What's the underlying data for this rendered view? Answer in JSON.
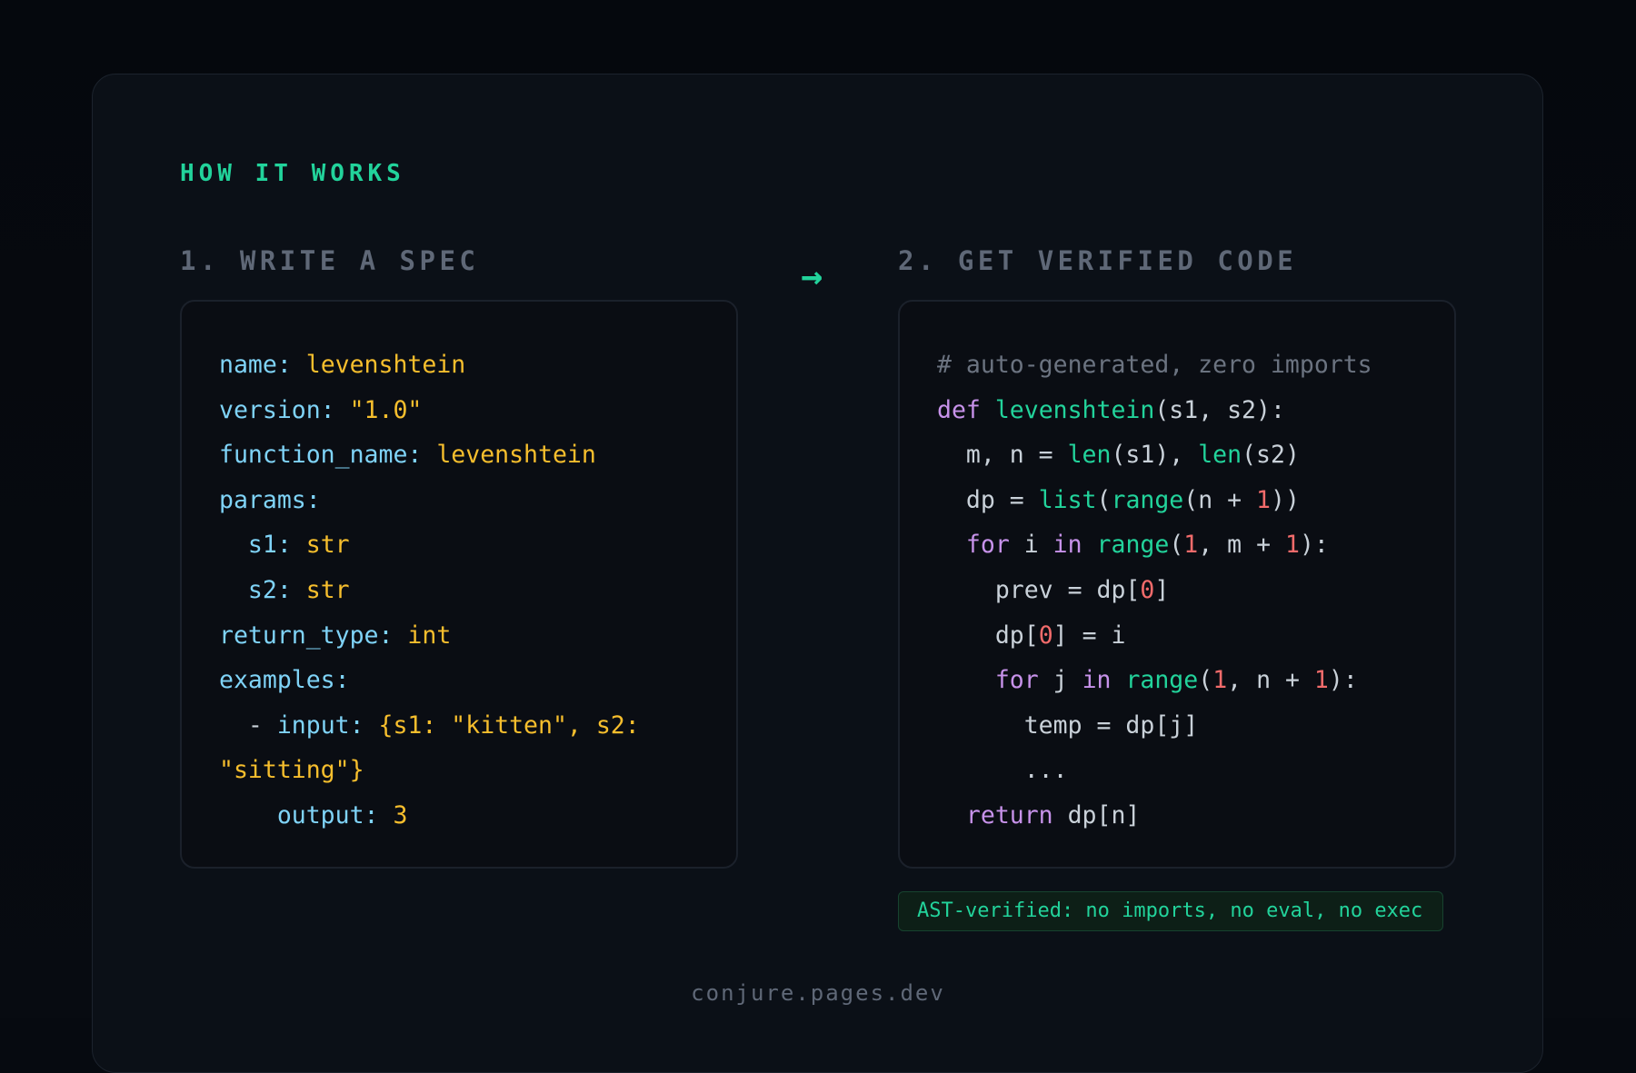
{
  "section_label": "HOW IT WORKS",
  "steps": {
    "spec_title": "1. WRITE A SPEC",
    "code_title": "2. GET VERIFIED CODE",
    "arrow": "→"
  },
  "colors": {
    "accent": "#22d39b",
    "yaml_key": "#7fd3f7",
    "yaml_value": "#f6be2d",
    "comment": "#6b7380",
    "keyword": "#c792ea",
    "number": "#f26b6b",
    "text": "#c9d1d9"
  },
  "spec_lines": [
    [
      [
        "k",
        "name: "
      ],
      [
        "v",
        "levenshtein"
      ]
    ],
    [
      [
        "k",
        "version: "
      ],
      [
        "v",
        "\"1.0\""
      ]
    ],
    [
      [
        "k",
        "function_name: "
      ],
      [
        "v",
        "levenshtein"
      ]
    ],
    [
      [
        "k",
        "params:"
      ]
    ],
    [
      [
        "k",
        "  s1: "
      ],
      [
        "v",
        "str"
      ]
    ],
    [
      [
        "k",
        "  s2: "
      ],
      [
        "v",
        "str"
      ]
    ],
    [
      [
        "k",
        "return_type: "
      ],
      [
        "v",
        "int"
      ]
    ],
    [
      [
        "k",
        "examples:"
      ]
    ],
    [
      [
        "tx",
        "  - "
      ],
      [
        "k",
        "input: "
      ],
      [
        "v",
        "{s1: \"kitten\", s2:"
      ]
    ],
    [
      [
        "v",
        "\"sitting\"}"
      ]
    ],
    [
      [
        "k",
        "    output: "
      ],
      [
        "v",
        "3"
      ]
    ]
  ],
  "code_lines": [
    [
      [
        "cm",
        "# auto-generated, zero imports"
      ]
    ],
    [
      [
        "kw",
        "def "
      ],
      [
        "fn",
        "levenshtein"
      ],
      [
        "tx",
        "(s1, s2):"
      ]
    ],
    [
      [
        "tx",
        "  m, n = "
      ],
      [
        "fn",
        "len"
      ],
      [
        "tx",
        "(s1), "
      ],
      [
        "fn",
        "len"
      ],
      [
        "tx",
        "(s2)"
      ]
    ],
    [
      [
        "tx",
        "  dp = "
      ],
      [
        "fn",
        "list"
      ],
      [
        "tx",
        "("
      ],
      [
        "fn",
        "range"
      ],
      [
        "tx",
        "(n + "
      ],
      [
        "nm",
        "1"
      ],
      [
        "tx",
        "))"
      ]
    ],
    [
      [
        "kw",
        "  for "
      ],
      [
        "tx",
        "i "
      ],
      [
        "kw",
        "in "
      ],
      [
        "fn",
        "range"
      ],
      [
        "tx",
        "("
      ],
      [
        "nm",
        "1"
      ],
      [
        "tx",
        ", m + "
      ],
      [
        "nm",
        "1"
      ],
      [
        "tx",
        "):"
      ]
    ],
    [
      [
        "tx",
        "    prev = dp["
      ],
      [
        "nm",
        "0"
      ],
      [
        "tx",
        "]"
      ]
    ],
    [
      [
        "tx",
        "    dp["
      ],
      [
        "nm",
        "0"
      ],
      [
        "tx",
        "] = i"
      ]
    ],
    [
      [
        "kw",
        "    for "
      ],
      [
        "tx",
        "j "
      ],
      [
        "kw",
        "in "
      ],
      [
        "fn",
        "range"
      ],
      [
        "tx",
        "("
      ],
      [
        "nm",
        "1"
      ],
      [
        "tx",
        ", n + "
      ],
      [
        "nm",
        "1"
      ],
      [
        "tx",
        "):"
      ]
    ],
    [
      [
        "tx",
        "      temp = dp[j]"
      ]
    ],
    [
      [
        "tx",
        "      ..."
      ]
    ],
    [
      [
        "kw",
        "  return "
      ],
      [
        "tx",
        "dp[n]"
      ]
    ]
  ],
  "badge": "AST-verified: no imports, no eval, no exec",
  "footer": "conjure.pages.dev"
}
